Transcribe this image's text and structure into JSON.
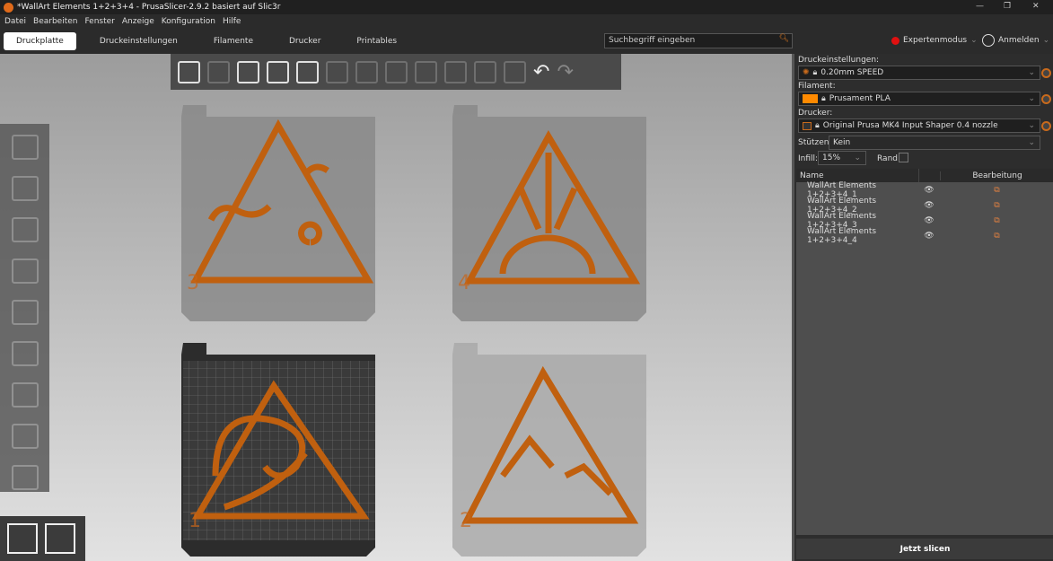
{
  "window": {
    "title": "*WallArt Elements 1+2+3+4 - PrusaSlicer-2.9.2 basiert auf Slic3r",
    "controls": [
      "—",
      "❐",
      "✕"
    ]
  },
  "menu": [
    "Datei",
    "Bearbeiten",
    "Fenster",
    "Anzeige",
    "Konfiguration",
    "Hilfe"
  ],
  "tabs": [
    "Druckplatte",
    "Druckeinstellungen",
    "Filamente",
    "Drucker",
    "Printables"
  ],
  "search": {
    "placeholder": "Suchbegriff eingeben"
  },
  "mode": "Expertenmodus",
  "login": "Anmelden",
  "plates": {
    "labels": [
      "3",
      "4",
      "1",
      "2"
    ]
  },
  "panel": {
    "print_label": "Druckeinstellungen:",
    "print_value": "0.20mm SPEED",
    "filament_label": "Filament:",
    "filament_value": "Prusament PLA",
    "filament_color": "#ff8a00",
    "printer_label": "Drucker:",
    "printer_value": "Original Prusa MK4 Input Shaper 0.4 nozzle",
    "supports_label": "Stützen:",
    "supports_value": "Kein",
    "infill_label": "Infill:",
    "infill_value": "15%",
    "brim_label": "Rand:",
    "brim_checked": false,
    "columns": [
      "Name",
      "Bearbeitung"
    ],
    "objects": [
      "WallArt Elements 1+2+3+4_1",
      "WallArt Elements 1+2+3+4_2",
      "WallArt Elements 1+2+3+4_3",
      "WallArt Elements 1+2+3+4_4"
    ],
    "slice_button": "Jetzt slicen"
  },
  "colors": {
    "accent": "#c86a1c",
    "model": "#c0600f"
  }
}
